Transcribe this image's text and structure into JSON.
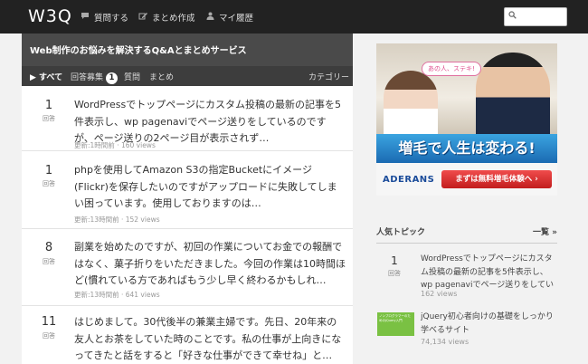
{
  "nav": {
    "logo": "W3Q",
    "items": [
      {
        "label": "質問する",
        "icon": "speech-bubble-icon"
      },
      {
        "label": "まとめ作成",
        "icon": "pencil-icon"
      },
      {
        "label": "マイ履歴",
        "icon": "person-icon"
      }
    ],
    "search_placeholder": ""
  },
  "main": {
    "title": "Web制作のお悩みを解決するQ&Aとまとめサービス",
    "tabs": {
      "all": "▶ すべて",
      "recruiting": "回答募集",
      "recruiting_count": "1",
      "questions": "質問",
      "matome": "まとめ",
      "category": "カテゴリー"
    },
    "answer_label": "回答",
    "questions": [
      {
        "count": "1",
        "title": "WordPressでトップページにカスタム投稿の最新の記事を5件表示し、wp pagenaviでページ送りをしているのですが、ページ送りの2ページ目が表示されず…",
        "updated": "更新:1時間前",
        "views": "160 views"
      },
      {
        "count": "1",
        "title": "phpを使用してAmazon S3の指定Bucketにイメージ(Flickr)を保存したいのですがアップロードに失敗してしまい困っています。使用しておりますのは…",
        "updated": "更新:13時間前",
        "views": "152 views"
      },
      {
        "count": "8",
        "title": "副業を始めたのですが、初回の作業についてお金での報酬ではなく、菓子折りをいただきました。今回の作業は10時間ほど(慣れている方であればもう少し早く終わるかもしれ…",
        "updated": "更新:13時間前",
        "views": "641 views"
      },
      {
        "count": "11",
        "title": "はじめまして。30代後半の兼業主婦です。先日、20年来の友人とお茶をしていた時のことです。私の仕事が上向きになってきたと話をすると「好きな仕事ができて幸せね」と…",
        "updated": "更新:13時間前",
        "views": ""
      }
    ]
  },
  "ad": {
    "bubble": "あの人、ステキ!",
    "headline": "増毛で人生は変わる!",
    "brand": "ADERANS",
    "cta": "まずは無料増毛体験へ ›"
  },
  "sidebar": {
    "heading": "人気トピック",
    "more": "一覧 »",
    "topics": [
      {
        "count": "1",
        "count_label": "回答",
        "title": "WordPressでトップページにカスタム投稿の最新の記事を5件表示し、wp pagenaviでページ送りをしている…",
        "views": "162 views"
      },
      {
        "thumb_text": "ノンプログラマーのためのjQuery入門",
        "title": "jQuery初心者向けの基礎をしっかり学べるサイト",
        "views": "74,134 views"
      }
    ]
  },
  "colors": {
    "topbar": "#222222",
    "main_header": "#4a4a4a",
    "tabbar": "#3d3d3d",
    "background": "#f2f2f2",
    "ad_headline": "#1b6ab2",
    "ad_button": "#c21d1d",
    "thumb_green": "#7ac143"
  }
}
